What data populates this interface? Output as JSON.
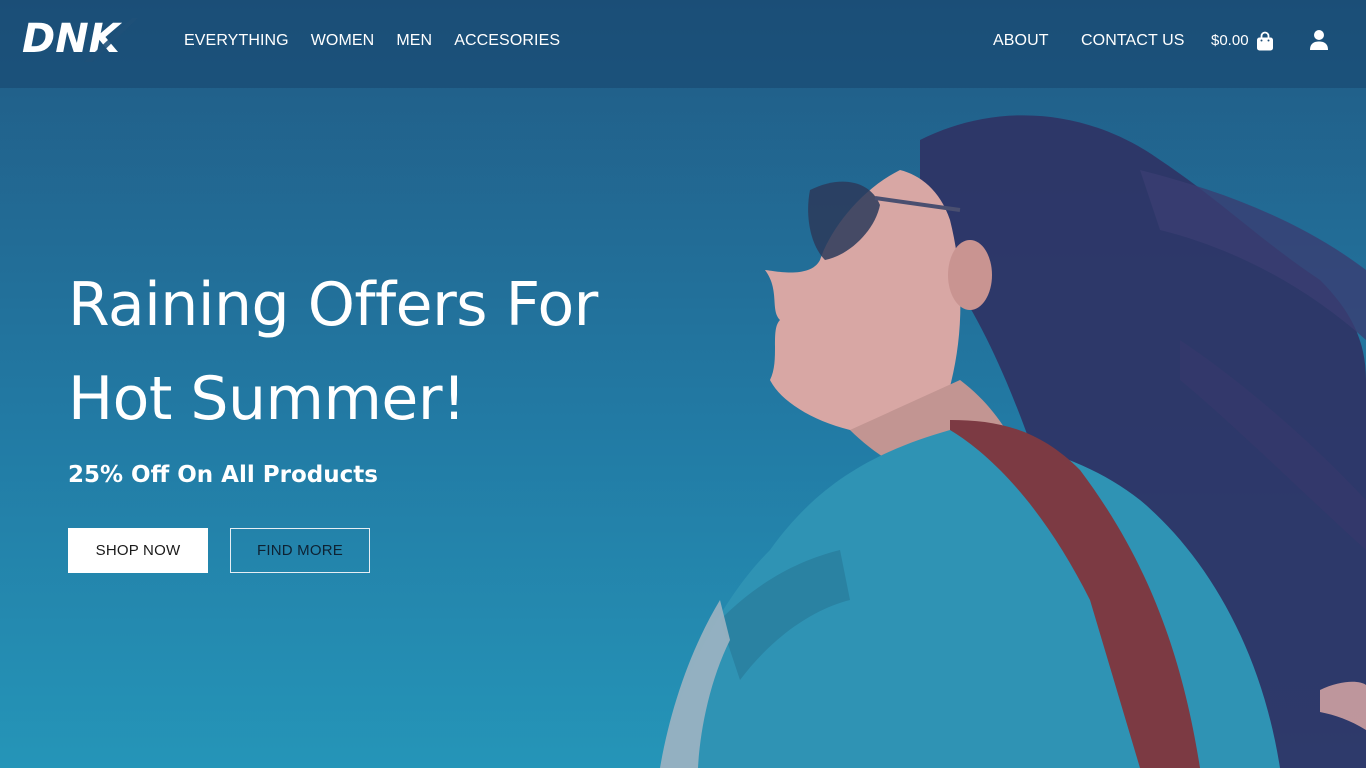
{
  "brand": {
    "logo_text": "DNK"
  },
  "nav": {
    "left": [
      "EVERYTHING",
      "WOMEN",
      "MEN",
      "ACCESORIES"
    ],
    "about": "ABOUT",
    "contact": "CONTACT US",
    "cart_total": "$0.00",
    "icons": {
      "cart": "shopping-bag-icon",
      "account": "user-icon"
    }
  },
  "hero": {
    "title_line1": "Raining Offers For",
    "title_line2": "Hot Summer!",
    "subtitle": "25% Off On All Products",
    "shop_label": "SHOP NOW",
    "find_label": "FIND MORE"
  },
  "colors": {
    "header_bg": "#1f5078",
    "hero_top": "#215a84",
    "hero_bottom": "#2595b8",
    "button_bg": "#ffffff"
  }
}
